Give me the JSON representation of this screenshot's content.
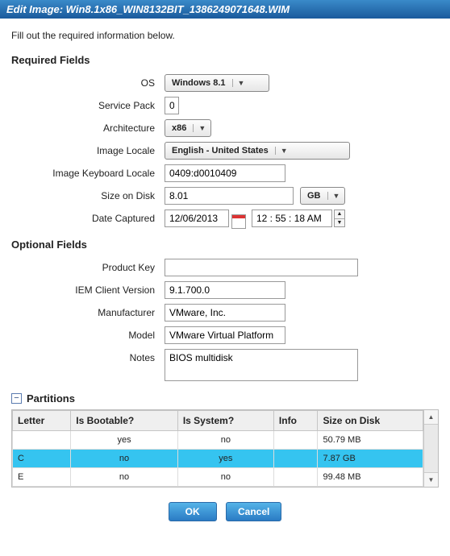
{
  "title": "Edit Image: Win8.1x86_WIN8132BIT_1386249071648.WIM",
  "intro": "Fill out the required information below.",
  "required_heading": "Required Fields",
  "optional_heading": "Optional Fields",
  "labels": {
    "os": "OS",
    "service_pack": "Service Pack",
    "architecture": "Architecture",
    "image_locale": "Image Locale",
    "keyboard_locale": "Image Keyboard Locale",
    "size_disk": "Size on Disk",
    "date_captured": "Date Captured",
    "product_key": "Product Key",
    "iem_version": "IEM Client Version",
    "manufacturer": "Manufacturer",
    "model": "Model",
    "notes": "Notes"
  },
  "values": {
    "os": "Windows 8.1",
    "service_pack": "0",
    "architecture": "x86",
    "image_locale": "English - United States",
    "keyboard_locale": "0409:d0010409",
    "size_disk": "8.01",
    "size_unit": "GB",
    "date_captured": "12/06/2013",
    "time_captured": "12 : 55 : 18 AM",
    "product_key": "",
    "iem_version": "9.1.700.0",
    "manufacturer": "VMware, Inc.",
    "model": "VMware Virtual Platform",
    "notes": "BIOS multidisk"
  },
  "partitions": {
    "heading": "Partitions",
    "columns": [
      "Letter",
      "Is Bootable?",
      "Is System?",
      "Info",
      "Size on Disk"
    ],
    "rows": [
      {
        "letter": "",
        "boot": "yes",
        "sys": "no",
        "info": "",
        "size": "50.79 MB",
        "selected": false
      },
      {
        "letter": "C",
        "boot": "no",
        "sys": "yes",
        "info": "",
        "size": "7.87 GB",
        "selected": true
      },
      {
        "letter": "E",
        "boot": "no",
        "sys": "no",
        "info": "",
        "size": "99.48 MB",
        "selected": false
      }
    ]
  },
  "buttons": {
    "ok": "OK",
    "cancel": "Cancel"
  }
}
